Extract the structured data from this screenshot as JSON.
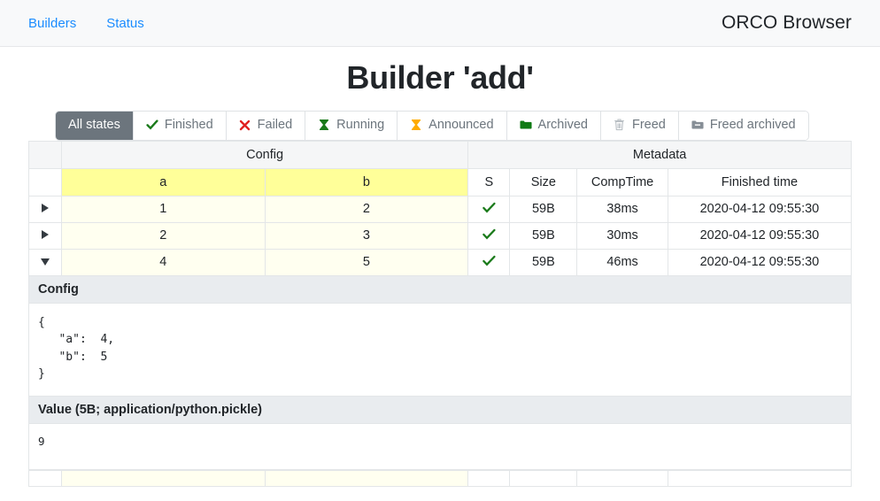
{
  "navbar": {
    "links": [
      {
        "label": "Builders"
      },
      {
        "label": "Status"
      }
    ],
    "brand": "ORCO Browser"
  },
  "page": {
    "title": "Builder 'add'"
  },
  "tabs": [
    {
      "label": "All states",
      "icon": "none",
      "active": true,
      "color": "#ffffff"
    },
    {
      "label": "Finished",
      "icon": "check-icon",
      "active": false,
      "color": "#1a7a1a"
    },
    {
      "label": "Failed",
      "icon": "cross-icon",
      "active": false,
      "color": "#e02020"
    },
    {
      "label": "Running",
      "icon": "hourglass-icon",
      "active": false,
      "color": "#1a7a1a"
    },
    {
      "label": "Announced",
      "icon": "hourglass-icon",
      "active": false,
      "color": "#ffab00"
    },
    {
      "label": "Archived",
      "icon": "folder-icon",
      "active": false,
      "color": "#1a7a1a"
    },
    {
      "label": "Freed",
      "icon": "trash-icon",
      "active": false,
      "color": "#adb5bd"
    },
    {
      "label": "Freed archived",
      "icon": "folder-open-icon",
      "active": false,
      "color": "#6c757d"
    }
  ],
  "table": {
    "group_headers": [
      {
        "label": "Config",
        "span": 2
      },
      {
        "label": "Metadata",
        "span": 4
      }
    ],
    "columns": [
      {
        "label": "a",
        "group": "config"
      },
      {
        "label": "b",
        "group": "config"
      },
      {
        "label": "S",
        "group": "meta"
      },
      {
        "label": "Size",
        "group": "meta"
      },
      {
        "label": "CompTime",
        "group": "meta"
      },
      {
        "label": "Finished time",
        "group": "meta"
      }
    ],
    "rows": [
      {
        "expanded": false,
        "arrow": "triangle-right",
        "a": "1",
        "b": "2",
        "state_icon": "check-icon",
        "state": "✔",
        "size": "59B",
        "comptime": "38ms",
        "finished_time": "2020-04-12 09:55:30"
      },
      {
        "expanded": false,
        "arrow": "triangle-right",
        "a": "2",
        "b": "3",
        "state_icon": "check-icon",
        "state": "✔",
        "size": "59B",
        "comptime": "30ms",
        "finished_time": "2020-04-12 09:55:30"
      },
      {
        "expanded": true,
        "arrow": "triangle-down",
        "a": "4",
        "b": "5",
        "state_icon": "check-icon",
        "state": "✔",
        "size": "59B",
        "comptime": "46ms",
        "finished_time": "2020-04-12 09:55:30"
      }
    ]
  },
  "detail": {
    "config": {
      "header": "Config",
      "body": "{\n   \"a\":  4,\n   \"b\":  5\n}"
    },
    "value": {
      "header": "Value (5B; application/python.pickle)",
      "body": "9"
    }
  },
  "colors": {
    "accent_link": "#1a8cff",
    "active_tab_bg": "#6c757d",
    "config_header_bg": "#ffff99",
    "config_cell_bg": "#fffff0",
    "panel_header_bg": "#e9ecef",
    "success": "#1a7a1a",
    "danger": "#e02020",
    "warning": "#ffab00"
  }
}
